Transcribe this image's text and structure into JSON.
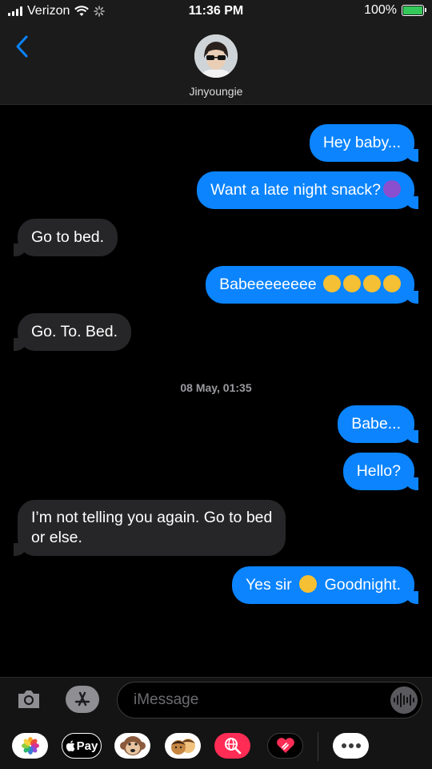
{
  "status_bar": {
    "carrier": "Verizon",
    "time": "11:36 PM",
    "battery": "100%"
  },
  "header": {
    "contact_name": "Jinyoungie"
  },
  "messages": [
    {
      "direction": "sent",
      "text": "Hey baby...",
      "emojis": []
    },
    {
      "direction": "sent",
      "text": "Want a late night snack?",
      "emojis": [
        "smiling-devil"
      ]
    },
    {
      "direction": "received",
      "text": "Go to bed.",
      "emojis": []
    },
    {
      "direction": "sent",
      "text": "Babeeeeeeee",
      "emojis": [
        "pleading-face",
        "confounded-face",
        "tired-face",
        "loudly-crying-face"
      ]
    },
    {
      "direction": "received",
      "text": "Go. To. Bed.",
      "emojis": []
    },
    {
      "direction": "sent",
      "text": "Babe...",
      "emojis": []
    },
    {
      "direction": "sent",
      "text": "Hello?",
      "emojis": []
    },
    {
      "direction": "received",
      "text_line1": "I’m not telling you again. Go to bed",
      "text_line2": "or else.",
      "emojis": []
    },
    {
      "direction": "sent",
      "text_before": "Yes sir",
      "text_after": "Goodnight.",
      "emojis": [
        "flushed-face"
      ]
    }
  ],
  "date_separator": "08 May, 01:35",
  "input": {
    "placeholder": "iMessage"
  },
  "app_drawer": {
    "apple_pay_label": "Pay"
  },
  "colors": {
    "sent_bubble": "#0b84fe",
    "received_bubble": "#262628",
    "background": "#000000",
    "header_bg": "#1b1b1b",
    "accent": "#0a84ff",
    "battery": "#34c759"
  }
}
